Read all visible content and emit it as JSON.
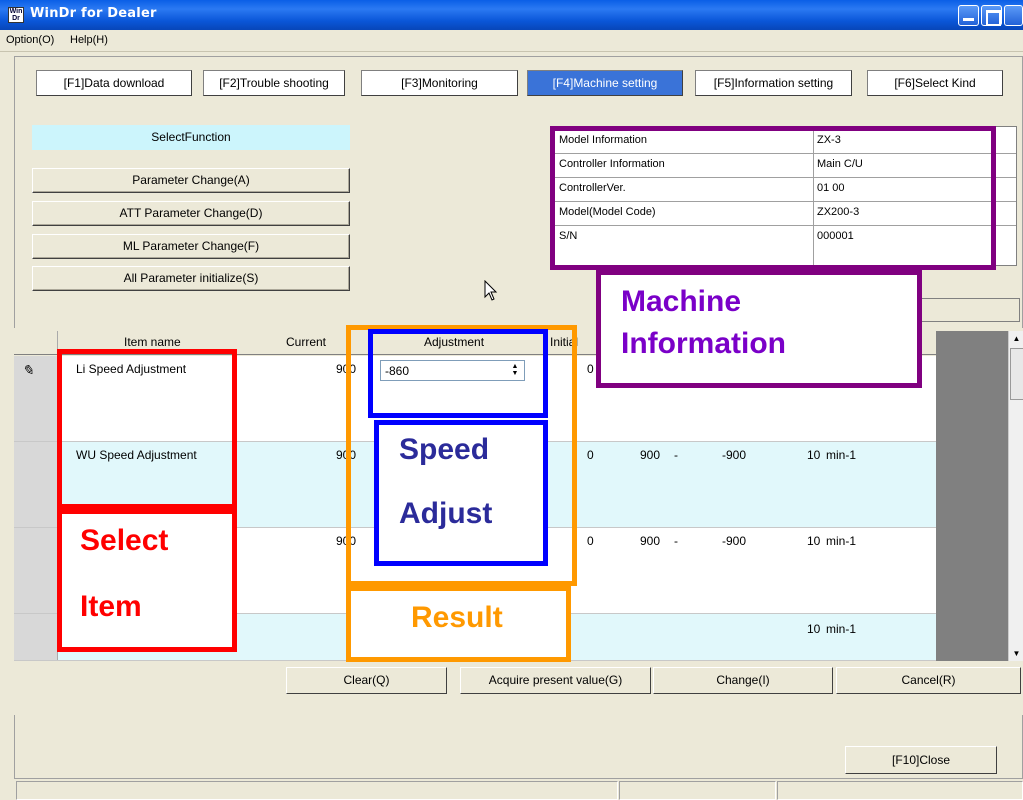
{
  "window": {
    "title": "WinDr for Dealer",
    "icon_text": "Win Dr"
  },
  "menu": [
    {
      "label": "Option(O)"
    },
    {
      "label": "Help(H)"
    }
  ],
  "tabs": [
    {
      "label": "[F1]Data download"
    },
    {
      "label": "[F2]Trouble shooting"
    },
    {
      "label": "[F3]Monitoring"
    },
    {
      "label": "[F4]Machine setting",
      "active": true
    },
    {
      "label": "[F5]Information setting"
    },
    {
      "label": "[F6]Select Kind"
    }
  ],
  "functions": {
    "header": "SelectFunction",
    "buttons": [
      {
        "label": "Parameter Change(A)"
      },
      {
        "label": "ATT Parameter Change(D)"
      },
      {
        "label": "ML Parameter Change(F)"
      },
      {
        "label": "All Parameter initialize(S)"
      }
    ]
  },
  "info": [
    {
      "label": "Model Information",
      "value": "ZX-3"
    },
    {
      "label": "Controller Information",
      "value": "Main C/U"
    },
    {
      "label": "ControllerVer.",
      "value": "01 00"
    },
    {
      "label": "Model(Model Code)",
      "value": "ZX200-3"
    },
    {
      "label": "S/N",
      "value": "000001"
    }
  ],
  "grid": {
    "columns": {
      "item": "Item name",
      "current": "Current",
      "adjust": "Adjustment",
      "initial": "Initial"
    },
    "rows": [
      {
        "name": "Li Speed Adjustment",
        "current": "900",
        "adjust": "-860",
        "initial": "0",
        "max": "",
        "min": "",
        "step": "",
        "unit": ""
      },
      {
        "name": "WU Speed Adjustment",
        "current": "900",
        "adjust": "",
        "initial": "0",
        "max": "900",
        "min": "-900",
        "step": "10",
        "unit": "min-1"
      },
      {
        "name": "",
        "current": "900",
        "adjust": "",
        "initial": "0",
        "max": "900",
        "min": "-900",
        "step": "10",
        "unit": "min-1"
      },
      {
        "name": "",
        "current": "",
        "adjust": "",
        "initial": "",
        "max": "",
        "min": "",
        "step": "10",
        "unit": "min-1"
      }
    ]
  },
  "actions": [
    {
      "label": "Clear(Q)"
    },
    {
      "label": "Acquire present value(G)"
    },
    {
      "label": "Change(I)"
    },
    {
      "label": "Cancel(R)"
    }
  ],
  "close_label": "[F10]Close",
  "annotations": {
    "machine_info": [
      "Machine",
      "Information"
    ],
    "speed_adjust": [
      "Speed",
      "Adjust"
    ],
    "select_item": [
      "Select",
      "Item"
    ],
    "result": "Result",
    "colors": {
      "red": "#ff0000",
      "orange": "#ff9900",
      "blue": "#0000ff",
      "purple": "#800080",
      "purple_text": "#7a00c8",
      "blue_text": "#2b2b9a"
    }
  },
  "colors": {
    "title_blue": "#0a5fe6",
    "active_tab": "#3a73d8",
    "func_header": "#ccf5fc",
    "row_light": "#e1f8fb"
  }
}
